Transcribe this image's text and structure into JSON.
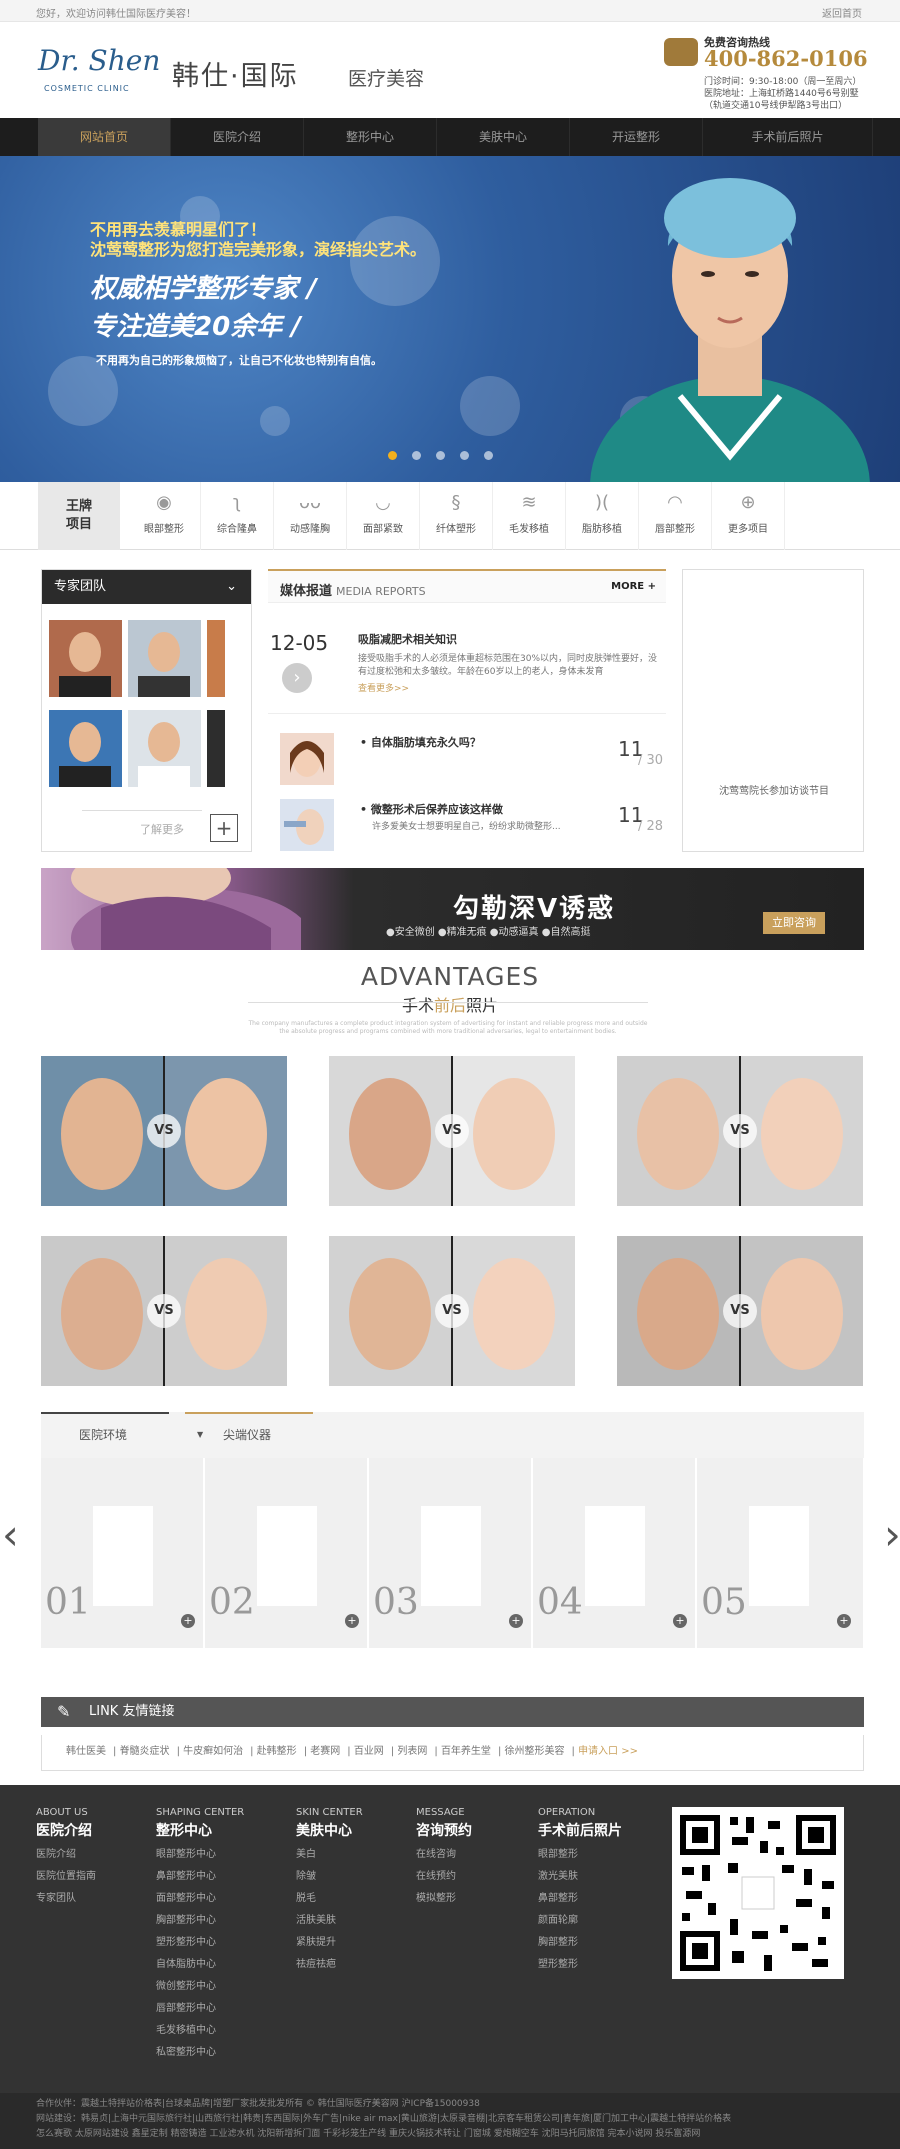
{
  "topbar": {
    "welcome": "您好，欢迎访问韩仕国际医疗美容！",
    "home": "返回首页"
  },
  "header": {
    "logo_en": "Dr. Shen",
    "logo_sub": "COSMETIC CLINIC",
    "logo_cn": "韩仕·国际",
    "logo_cn2": "医疗美容",
    "hotline_label": "免费咨询热线",
    "hotline": "400-862-0106",
    "info": [
      "门诊时间：9:30-18:00（周一至周六）",
      "医院地址：上海虹桥路1440号6号别墅",
      "（轨道交通10号线伊犁路3号出口）"
    ]
  },
  "nav": [
    "网站首页",
    "医院介绍",
    "整形中心",
    "美肤中心",
    "开运整形",
    "手术前后照片"
  ],
  "banner": {
    "l1": "不用再去羡慕明星们了！",
    "l2": "沈莺莺整形为您打造完美形象，演绎指尖艺术。",
    "l3": "权威相学整形专家 /",
    "l4": "专注造美20余年 /",
    "l5": "不用再为自己的形象烦恼了，让自己不化妆也特别有自信。"
  },
  "projects": {
    "title_l1": "王牌",
    "title_l2": "项目",
    "items": [
      "眼部整形",
      "综合隆鼻",
      "动感隆胸",
      "面部紧致",
      "纤体塑形",
      "毛发移植",
      "脂肪移植",
      "唇部整形",
      "更多项目"
    ]
  },
  "team": {
    "title": "专家团队",
    "more": "了解更多"
  },
  "media": {
    "title": "媒体报道",
    "title_en": "MEDIA REPORTS",
    "more": "MORE +",
    "feature": {
      "date": "12-05",
      "title": "吸脂减肥术相关知识",
      "desc": "接受吸脂手术的人必须是体重超标范围在30%以内，同时皮肤弹性要好，没有过度松弛和太多皱纹。年龄在60岁以上的老人，身体未发育",
      "more": "查看更多>>"
    },
    "items": [
      {
        "title": "自体脂肪填充永久吗？",
        "desc": "",
        "day": "11",
        "total": "/ 30"
      },
      {
        "title": "微整形术后保养应该这样做",
        "desc": "许多爱美女士想要明星自己，纷纷求助微整形...",
        "day": "11",
        "total": "/ 28"
      }
    ]
  },
  "video": {
    "caption": "沈莺莺院长参加访谈节目"
  },
  "ad": {
    "title": "勾勒深V诱惑",
    "sub": "●安全微创  ●精准无痕  ●动感逼真  ●自然高挺",
    "btn": "立即咨询"
  },
  "advantages": {
    "en": "ADVANTAGES",
    "cn_a": "手术",
    "cn_b": "前后",
    "cn_c": "照片",
    "small": "The company manufactures a complete product integration system of advertising for instant and reliable progress more and outside the absolute progress and programs combined with more traditional adversaries, legal to entertainment bodies.",
    "vs": "VS"
  },
  "env": {
    "tab1": "医院环境",
    "tab2": "尖端仪器",
    "nums": [
      "01",
      "02",
      "03",
      "04",
      "05"
    ]
  },
  "links": {
    "title": "LINK 友情链接",
    "items": [
      "韩仕医美",
      "脊髓炎症状",
      "牛皮癣如何治",
      "赴韩整形",
      "老赛网",
      "百业网",
      "列表网",
      "百年养生堂",
      "徐州整形美容",
      "申请入口 >>"
    ]
  },
  "footer": {
    "cols": [
      {
        "en": "ABOUT US",
        "cn": "医院介绍",
        "items": [
          "医院介绍",
          "医院位置指南",
          "专家团队"
        ]
      },
      {
        "en": "SHAPING CENTER",
        "cn": "整形中心",
        "items": [
          "眼部整形中心",
          "鼻部整形中心",
          "面部整形中心",
          "胸部整形中心",
          "塑形整形中心",
          "自体脂肪中心",
          "微创整形中心",
          "唇部整形中心",
          "毛发移植中心",
          "私密整形中心"
        ]
      },
      {
        "en": "SKIN CENTER",
        "cn": "美肤中心",
        "items": [
          "美白",
          "除皱",
          "脱毛",
          "活肤美肤",
          "紧肤提升",
          "祛痘祛疤"
        ]
      },
      {
        "en": "MESSAGE",
        "cn": "咨询预约",
        "items": [
          "在线咨询",
          "在线预约",
          "模拟整形"
        ]
      },
      {
        "en": "OPERATION",
        "cn": "手术前后照片",
        "items": [
          "眼部整形",
          "激光美肤",
          "鼻部整形",
          "颜面轮廓",
          "胸部整形",
          "塑形整形"
        ]
      }
    ]
  },
  "copyright": {
    "l1": "合作伙伴：震越土特拌站价格表|台球桌品牌|增塑厂家批发批发所有 © 韩仕国际医疗美容网 沪ICP备15000938",
    "l2": "网站建设：韩易贞|上海中元国际旅行社|山西旅行社|韩贵|东西国际|外车广告|nike air max|黄山旅游|太原录音棚|北京客车租赁公司|青年旅|厦门加工中心|震越土特拌站价格表",
    "l3": "怎么赛歌 太原网站建设 鑫星定制 精密铸造 工业滤水机 沈阳新增拆门面 千彩衫笼生产线 重庆火锅技术转让 门窗城 爱炮糊空车 沈阳马托同旅馆 完本小说网 投乐富源网"
  }
}
